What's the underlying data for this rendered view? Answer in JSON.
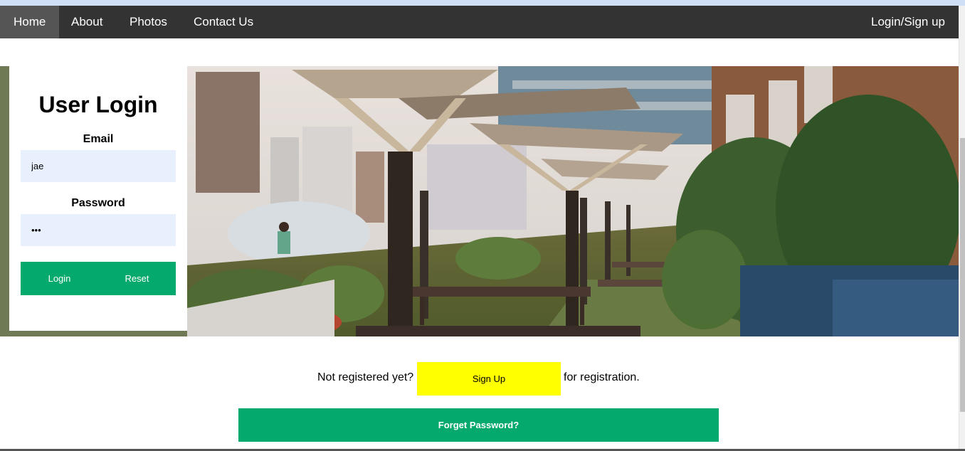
{
  "nav": {
    "items": [
      {
        "label": "Home",
        "active": true
      },
      {
        "label": "About"
      },
      {
        "label": "Photos"
      },
      {
        "label": "Contact Us"
      }
    ],
    "login_signup": "Login/Sign up"
  },
  "login": {
    "title": "User Login",
    "email_label": "Email",
    "email_value": "jae",
    "password_label": "Password",
    "password_value": "•••",
    "login_button": "Login",
    "reset_button": "Reset"
  },
  "register": {
    "prefix": "Not registered yet?",
    "signup_button": "Sign Up",
    "suffix": "for registration."
  },
  "forget_button": "Forget Password?",
  "colors": {
    "navbar": "#333333",
    "active_nav": "#555555",
    "primary_green": "#04aa6d",
    "signup_yellow": "#ffff00",
    "input_bg": "#e8f0fe"
  }
}
